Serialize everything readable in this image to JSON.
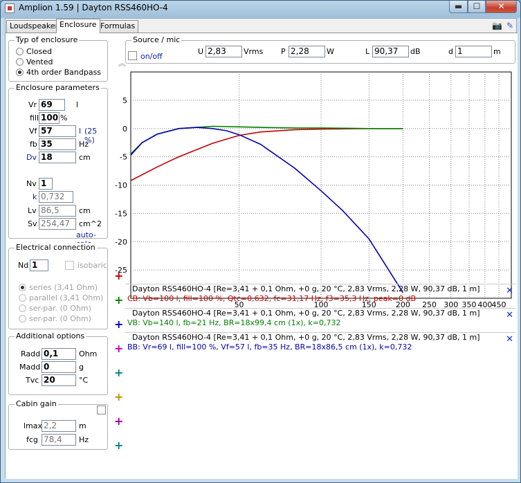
{
  "window": {
    "title": "Amplion 1.59 | Dayton RSS460HO-4",
    "min": "▬",
    "max": "☐",
    "close": "✕"
  },
  "tabs": [
    {
      "label": "Loudspeaker"
    },
    {
      "label": "Enclosure"
    },
    {
      "label": "Formulas"
    }
  ],
  "enclosure_type": {
    "legend": "Typ of enclosure",
    "options": [
      {
        "label": "Closed",
        "selected": false
      },
      {
        "label": "Vented",
        "selected": false
      },
      {
        "label": "4th order Bandpass",
        "selected": true
      }
    ]
  },
  "enclosure_params": {
    "legend": "Enclosure parameters",
    "vr": {
      "label": "Vr",
      "value": "69",
      "unit": "l"
    },
    "fill": {
      "label": "fill",
      "value": "100",
      "unit": "%"
    },
    "vf": {
      "label": "Vf",
      "value": "57",
      "unit": "l",
      "extra": "(25 %)"
    },
    "fb": {
      "label": "fb",
      "value": "35",
      "unit": "Hz"
    },
    "dv": {
      "label": "Dv",
      "value": "18",
      "unit": "cm"
    },
    "nv": {
      "label": "Nv",
      "value": "1"
    },
    "k": {
      "label": "k",
      "value": "0,732"
    },
    "lv": {
      "label": "Lv",
      "value": "86,5",
      "unit": "cm"
    },
    "sv": {
      "label": "Sv",
      "value": "254,47",
      "unit": "cm^2"
    },
    "autocalc": "auto-calc"
  },
  "electrical": {
    "legend": "Electrical connection",
    "nd": {
      "label": "Nd",
      "value": "1"
    },
    "isobaric": "isobaric",
    "options": [
      {
        "label": "series (3,41 Ohm)",
        "selected": true
      },
      {
        "label": "parallel (3,41 Ohm)",
        "selected": false
      },
      {
        "label": "ser-par. (0 Ohm)",
        "selected": false
      },
      {
        "label": "ser-par. (0 Ohm)",
        "selected": false
      }
    ]
  },
  "additional": {
    "legend": "Additional options",
    "radd": {
      "label": "Radd",
      "value": "0,1",
      "unit": "Ohm"
    },
    "madd": {
      "label": "Madd",
      "value": "0",
      "unit": "g"
    },
    "tvc": {
      "label": "Tvc",
      "value": "20",
      "unit": "°C"
    }
  },
  "cabin": {
    "legend": "Cabin gain",
    "lmax": {
      "label": "lmax",
      "value": "2,2",
      "unit": "m"
    },
    "fcg": {
      "label": "fcg",
      "value": "78,4",
      "unit": "Hz"
    }
  },
  "source": {
    "legend": "Source / mic",
    "onoff": "on/off",
    "u": {
      "label": "U",
      "value": "2,83",
      "unit": "Vrms"
    },
    "p": {
      "label": "P",
      "value": "2,28",
      "unit": "W"
    },
    "l": {
      "label": "L",
      "value": "90,37",
      "unit": "dB"
    },
    "d": {
      "label": "d",
      "value": "1",
      "unit": "m"
    }
  },
  "chart_data": {
    "type": "line",
    "xscale": "log",
    "xlim": [
      20,
      500
    ],
    "ylim": [
      -30,
      10
    ],
    "x_ticks": [
      "50",
      "100",
      "150",
      "200",
      "250",
      "300",
      "350",
      "400",
      "450"
    ],
    "y_ticks": [
      "5",
      "0",
      "-5",
      "-10",
      "-15",
      "-20",
      "-25"
    ],
    "grid": true,
    "series": [
      {
        "color": "#c00000",
        "x": [
          20,
          25,
          30,
          40,
          50,
          60,
          80,
          100,
          150,
          200
        ],
        "y": [
          -9.2,
          -6.8,
          -5.0,
          -2.6,
          -1.2,
          -0.6,
          -0.2,
          -0.1,
          0,
          0
        ]
      },
      {
        "color": "#008000",
        "x": [
          20,
          22,
          25,
          30,
          40,
          50,
          60,
          80,
          100,
          150,
          200
        ],
        "y": [
          -4.5,
          -2.5,
          -1.0,
          0,
          0.4,
          0.3,
          0.2,
          0.1,
          0.1,
          0,
          0
        ]
      },
      {
        "color": "#0000b0",
        "x": [
          20,
          22,
          25,
          30,
          35,
          40,
          45,
          50,
          60,
          80,
          100,
          120,
          150,
          200
        ],
        "y": [
          -4.7,
          -2.5,
          -1.0,
          0,
          0.2,
          0,
          -0.4,
          -1.1,
          -2.8,
          -7.0,
          -11.0,
          -14.5,
          -19.5,
          -29.0
        ]
      }
    ]
  },
  "results": [
    {
      "color": "#c00000",
      "l1": "Dayton RSS460HO-4 [Re=3,41 + 0,1 Ohm, +0 g, 20 °C, 2,83 Vrms, 2,28 W, 90,37 dB, 1 m]",
      "l2": "CB: Vb=100 l, fill=100 %, Qtc=0,632, fc=31,17 Hz, f3=35,3 Hz, peak=0 dB"
    },
    {
      "color": "#008000",
      "l1": "Dayton RSS460HO-4 [Re=3,41 + 0,1 Ohm, +0 g, 20 °C, 2,83 Vrms, 2,28 W, 90,37 dB, 1 m]",
      "l2": "VB: Vb=140 l, fb=21 Hz, BR=18x99,4 cm (1x), k=0,732"
    },
    {
      "color": "#0000b0",
      "l1": "Dayton RSS460HO-4 [Re=3,41 + 0,1 Ohm, +0 g, 20 °C, 2,83 Vrms, 2,28 W, 90,37 dB, 1 m]",
      "l2": "BB: Vr=69 l, fill=100 %, Vf=57 l, fb=35 Hz, BR=18x86,5 cm (1x), k=0,732"
    }
  ],
  "plus_colors": [
    "#c00000",
    "#008000",
    "#0000b0",
    "#c000c0",
    "#008080",
    "#c09000",
    "#a000a0",
    "#008090"
  ],
  "plus_symbol": "+",
  "remove_symbol": "✕",
  "collapse_symbol": "︽",
  "camera_symbol": "📷",
  "pin_symbol": "✎"
}
